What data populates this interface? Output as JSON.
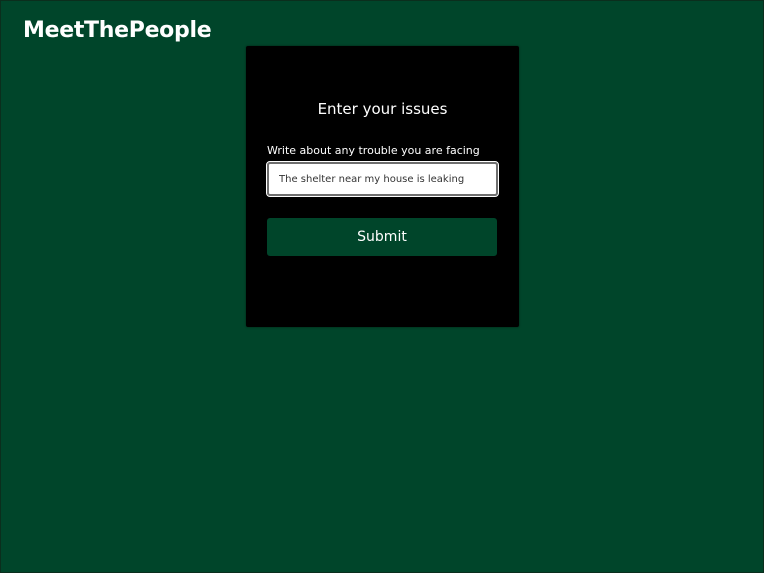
{
  "app": {
    "brand": "MeetThePeople"
  },
  "form": {
    "title": "Enter your issues",
    "label": "Write about any trouble you are facing",
    "input_value": "The shelter near my house is leaking",
    "submit_label": "Submit"
  },
  "colors": {
    "background": "#00452a",
    "card": "#000000",
    "button": "#00452a",
    "text": "#ffffff"
  }
}
